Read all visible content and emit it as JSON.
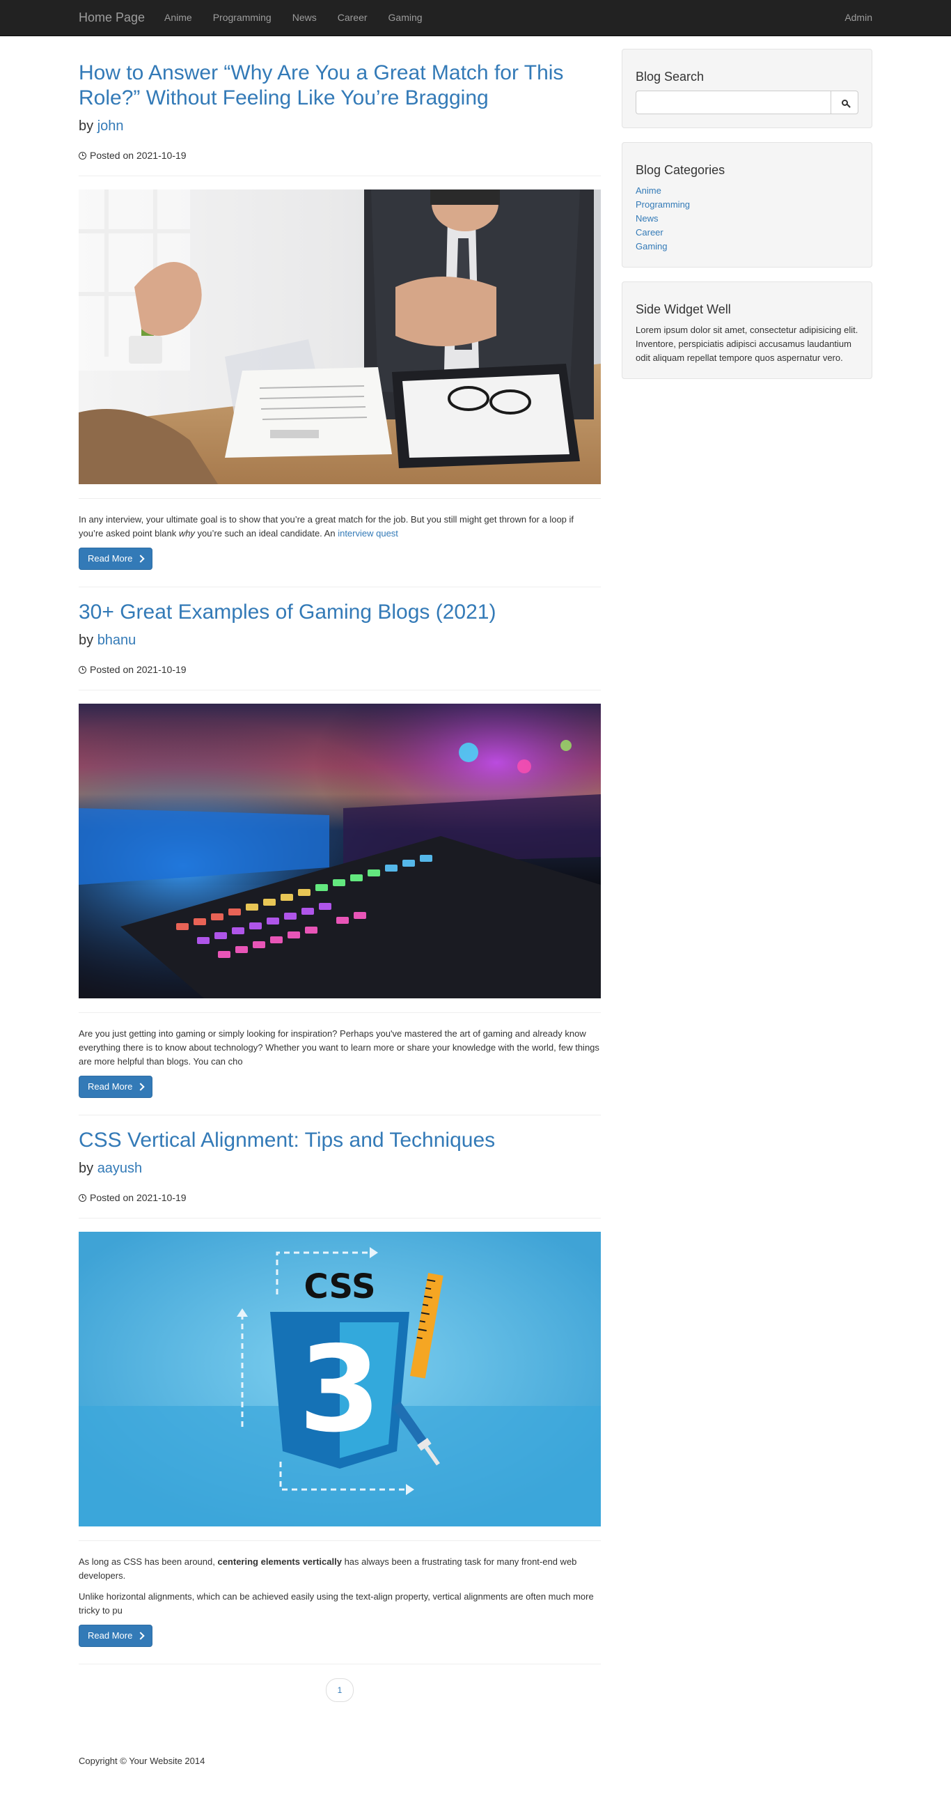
{
  "navbar": {
    "brand": "Home Page",
    "items": [
      "Anime",
      "Programming",
      "News",
      "Career",
      "Gaming"
    ],
    "admin": "Admin"
  },
  "posts": [
    {
      "title": "How to Answer “Why Are You a Great Match for This Role?” Without Feeling Like You’re Bragging",
      "by": "by",
      "author": "john",
      "date": "Posted on 2021-10-19",
      "excerpt_before": "In any interview, your ultimate goal is to show that you’re a great match for the job. But you still might get thrown for a loop if you’re asked point blank ",
      "excerpt_em": "why",
      "excerpt_after": " you’re such an ideal candidate. An ",
      "excerpt_link": "interview quest",
      "read_more": "Read More"
    },
    {
      "title": "30+ Great Examples of Gaming Blogs (2021)",
      "by": "by",
      "author": "bhanu",
      "date": "Posted on 2021-10-19",
      "excerpt": "Are you just getting into gaming or simply looking for inspiration? Perhaps you've mastered the art of gaming and already know everything there is to know about technology? Whether you want to learn more or share your knowledge with the world, few things are more helpful than blogs. You can cho",
      "read_more": "Read More"
    },
    {
      "title": "CSS Vertical Alignment: Tips and Techniques",
      "by": "by",
      "author": "aayush",
      "date": "Posted on 2021-10-19",
      "excerpt_p1_before": "As long as CSS has been around, ",
      "excerpt_p1_bold": "centering elements vertically",
      "excerpt_p1_after": " has always been a frustrating task for many front-end web developers.",
      "excerpt_p2": "Unlike horizontal alignments, which can be achieved easily using the text-align property, vertical alignments are often much more tricky to pu",
      "read_more": "Read More",
      "image_logo_text": "CSS",
      "image_shield_number": "3"
    }
  ],
  "pagination": {
    "current": "1"
  },
  "sidebar": {
    "search": {
      "title": "Blog Search",
      "placeholder": ""
    },
    "categories": {
      "title": "Blog Categories",
      "items": [
        "Anime",
        "Programming",
        "News",
        "Career",
        "Gaming"
      ]
    },
    "widget": {
      "title": "Side Widget Well",
      "text": "Lorem ipsum dolor sit amet, consectetur adipisicing elit. Inventore, perspiciatis adipisci accusamus laudantium odit aliquam repellat tempore quos aspernatur vero."
    }
  },
  "footer": {
    "text": "Copyright © Your Website 2014"
  }
}
